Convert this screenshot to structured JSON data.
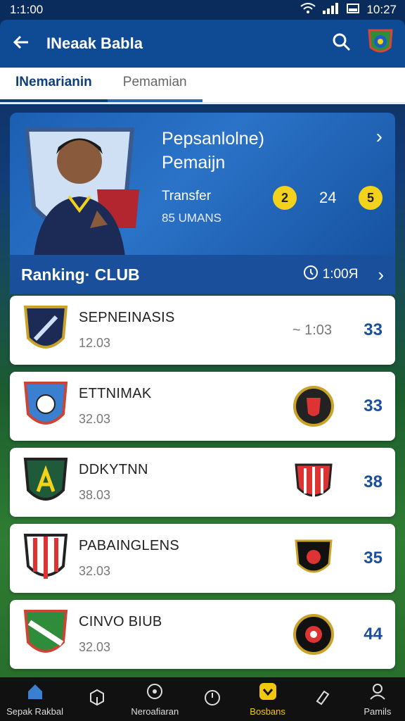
{
  "status": {
    "left": "1:1:00",
    "time": "10:27"
  },
  "appbar": {
    "title": "INeaak Babla"
  },
  "tabs": [
    {
      "label": "INemarianin"
    },
    {
      "label": "Pemamian"
    }
  ],
  "hero": {
    "title_line1": "Pepsanlolne)",
    "title_line2": "Pemaijn",
    "transfer_label": "Transfer",
    "value_label": "85 UMANS",
    "badge_left": "2",
    "stat_value": "24",
    "badge_right": "5"
  },
  "ranking": {
    "title": "Ranking· CLUB",
    "time": "1:00Я"
  },
  "clubs": [
    {
      "name": "SEPNEINASIS",
      "sub": "12.03",
      "delta": "~ 1:03",
      "score": "33"
    },
    {
      "name": "ETTNIMAK",
      "sub": "32.03",
      "score": "33"
    },
    {
      "name": "DDKYTNN",
      "sub": "38.03",
      "score": "38"
    },
    {
      "name": "PABAINGLENS",
      "sub": "32.03",
      "score": "35"
    },
    {
      "name": "CINVO BIUB",
      "sub": "32.03",
      "score": "44"
    }
  ],
  "nav": [
    {
      "label": "Sepak Rakbal"
    },
    {
      "label": ""
    },
    {
      "label": "Neroafiaran"
    },
    {
      "label": ""
    },
    {
      "label": "Bosbans"
    },
    {
      "label": ""
    },
    {
      "label": "Pamils"
    }
  ],
  "colors": {
    "primary": "#0f4a94",
    "accent": "#f3d21b",
    "score": "#1a4f9c"
  }
}
